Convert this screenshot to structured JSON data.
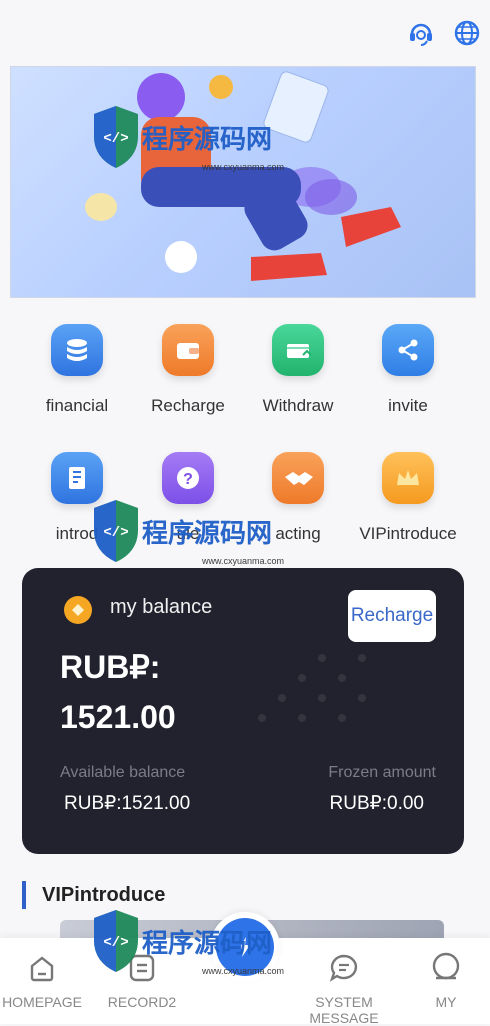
{
  "topbar": {
    "support_icon": "headset-icon",
    "language_icon": "globe-icon"
  },
  "watermark": {
    "text": "程序源码网",
    "url": "www.cxyuanma.com"
  },
  "menu": [
    {
      "label": "financial",
      "icon": "coins-stack-icon",
      "color": "#3f86e8"
    },
    {
      "label": "Recharge",
      "icon": "wallet-icon",
      "color": "#f08a36"
    },
    {
      "label": "Withdraw",
      "icon": "withdraw-card-icon",
      "color": "#2fc27f"
    },
    {
      "label": "invite",
      "icon": "share-icon",
      "color": "#3b8df0"
    },
    {
      "label": "introd",
      "icon": "book-icon",
      "color": "#3f86e8"
    },
    {
      "label": "ule",
      "icon": "question-icon",
      "color": "#8e5cf0"
    },
    {
      "label": "acting",
      "icon": "handshake-icon",
      "color": "#f08a36"
    },
    {
      "label": "VIPintroduce",
      "icon": "crown-icon",
      "color": "#f5a128"
    }
  ],
  "balance": {
    "title": "my balance",
    "recharge_label": "Recharge",
    "amount_line1": "RUB₽:",
    "amount_line2": "1521.00",
    "available_label": "Available balance",
    "available_value": "RUB₽:1521.00",
    "frozen_label": "Frozen amount",
    "frozen_value": "RUB₽:0.00"
  },
  "section": {
    "title": "VIPintroduce"
  },
  "tabs": [
    {
      "label": "HOMEPAGE"
    },
    {
      "label": "RECORD2"
    },
    {
      "label": "SYSTEM MESSAGE"
    },
    {
      "label": "MY"
    }
  ],
  "colors": {
    "accent": "#2e73e8",
    "card_bg": "#22222e"
  }
}
